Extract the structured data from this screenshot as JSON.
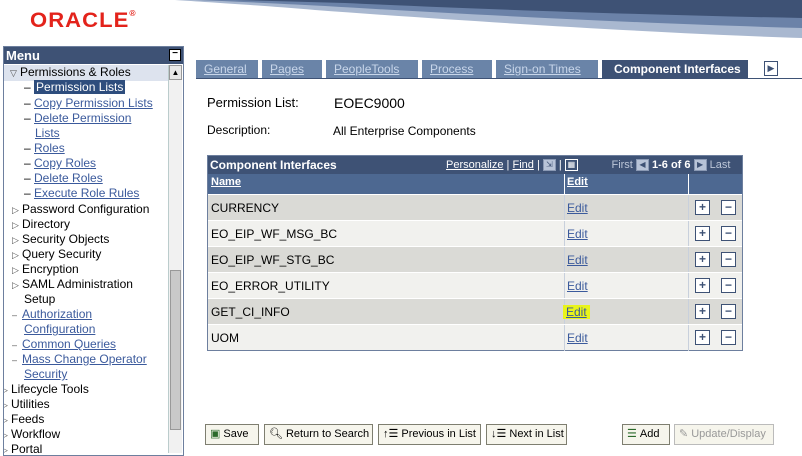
{
  "header": {
    "logo": "ORACLE",
    "logo_mark": "®"
  },
  "menu": {
    "title": "Menu",
    "collapse_icon": "−",
    "items": [
      {
        "label": "Permissions & Roles",
        "icon": "triangle-down"
      },
      {
        "label": "Permission Lists"
      },
      {
        "label": "Copy Permission Lists"
      },
      {
        "label": "Delete Permission"
      },
      {
        "label": "Lists"
      },
      {
        "label": "Roles"
      },
      {
        "label": "Copy Roles"
      },
      {
        "label": "Delete Roles"
      },
      {
        "label": "Execute Role Rules"
      },
      {
        "label": "Password Configuration"
      },
      {
        "label": "Directory"
      },
      {
        "label": "Security Objects"
      },
      {
        "label": "Query Security"
      },
      {
        "label": "Encryption"
      },
      {
        "label": "SAML Administration"
      },
      {
        "label": "Setup"
      },
      {
        "label": "Authorization"
      },
      {
        "label": "Configuration"
      },
      {
        "label": "Common Queries"
      },
      {
        "label": "Mass Change Operator"
      },
      {
        "label": "Security"
      },
      {
        "label": "Lifecycle Tools"
      },
      {
        "label": "Utilities"
      },
      {
        "label": "Feeds"
      },
      {
        "label": "Workflow"
      },
      {
        "label": "Portal"
      }
    ]
  },
  "tabs": [
    {
      "label": "General"
    },
    {
      "label": "Pages"
    },
    {
      "label": "PeopleTools"
    },
    {
      "label": "Process"
    },
    {
      "label": "Sign-on Times"
    },
    {
      "label": "Component Interfaces"
    }
  ],
  "form": {
    "permission_list_label": "Permission List:",
    "permission_list_value": "EOEC9000",
    "description_label": "Description:",
    "description_value": "All Enterprise Components"
  },
  "grid": {
    "title": "Component Interfaces",
    "personalize": "Personalize",
    "find": "Find",
    "separator": "|",
    "first": "First",
    "range": "1-6 of 6",
    "last": "Last",
    "col_name": "Name",
    "col_edit": "Edit",
    "rows": [
      {
        "name": "CURRENCY",
        "edit": "Edit"
      },
      {
        "name": "EO_EIP_WF_MSG_BC",
        "edit": "Edit"
      },
      {
        "name": "EO_EIP_WF_STG_BC",
        "edit": "Edit"
      },
      {
        "name": "EO_ERROR_UTILITY",
        "edit": "Edit"
      },
      {
        "name": "GET_CI_INFO",
        "edit": "Edit"
      },
      {
        "name": "UOM",
        "edit": "Edit"
      }
    ],
    "add_icon": "+",
    "remove_icon": "−"
  },
  "buttons": {
    "save": "Save",
    "return": "Return to Search",
    "previous": "Previous in List",
    "next": "Next in List",
    "add": "Add",
    "update": "Update/Display"
  }
}
